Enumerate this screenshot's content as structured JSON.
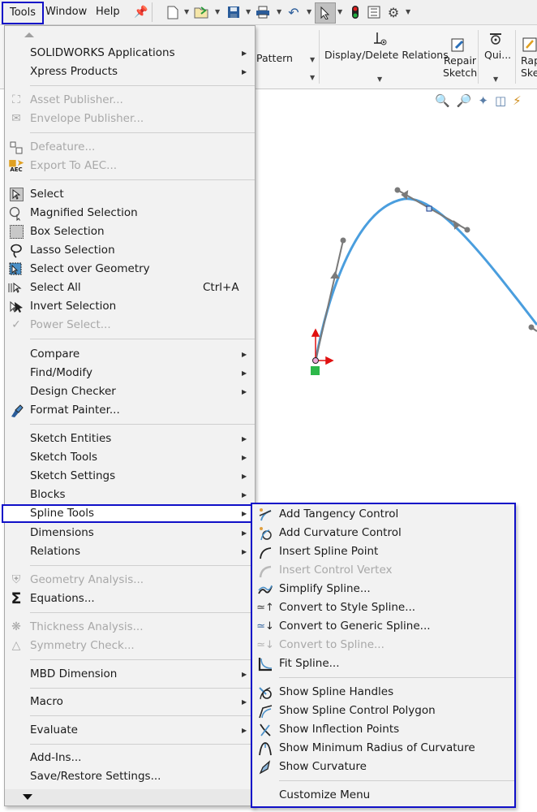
{
  "menubar": {
    "items": [
      {
        "label": "Tools",
        "active": true
      },
      {
        "label": "Window"
      },
      {
        "label": "Help"
      }
    ],
    "pin_icon": "pin-icon"
  },
  "toolbar": {
    "icons": [
      "new-document-icon",
      "open-folder-icon",
      "save-icon",
      "print-icon",
      "undo-icon",
      "select-pointer-icon",
      "traffic-light-icon",
      "file-properties-icon",
      "options-gear-icon"
    ]
  },
  "ribbon": {
    "pattern_label": "Pattern",
    "display_delete_relations_label": "Display/Delete Relations",
    "repair_sketch_label_line1": "Repair",
    "repair_sketch_label_line2": "Sketch",
    "quick_snaps_label": "Qui...",
    "rapid_sketch_label_line1": "Rap",
    "rapid_sketch_label_line2": "Ske"
  },
  "view_toolbar": {
    "icons": [
      "zoom-to-fit-icon",
      "zoom-to-area-icon",
      "previous-view-icon",
      "section-view-icon",
      "dynamic-annotation-icon"
    ]
  },
  "tools_menu": {
    "items": [
      {
        "label": "SOLIDWORKS Applications",
        "submenu": true
      },
      {
        "label": "Xpress Products",
        "submenu": true
      },
      {
        "label": "Asset Publisher...",
        "disabled": true,
        "icon": "asset-publisher-icon"
      },
      {
        "label": "Envelope Publisher...",
        "disabled": true,
        "icon": "envelope-publisher-icon"
      },
      {
        "label": "Defeature...",
        "disabled": true,
        "icon": "defeature-icon"
      },
      {
        "label": "Export To AEC...",
        "disabled": true,
        "icon": "export-aec-icon"
      },
      {
        "label": "Select",
        "icon": "select-icon"
      },
      {
        "label": "Magnified Selection",
        "icon": "magnified-selection-icon"
      },
      {
        "label": "Box Selection",
        "icon": "box-selection-icon"
      },
      {
        "label": "Lasso Selection",
        "icon": "lasso-selection-icon"
      },
      {
        "label": "Select over Geometry",
        "icon": "select-over-geometry-icon"
      },
      {
        "label": "Select All",
        "shortcut": "Ctrl+A",
        "icon": "select-all-icon"
      },
      {
        "label": "Invert Selection",
        "icon": "invert-selection-icon"
      },
      {
        "label": "Power Select...",
        "disabled": true,
        "icon": "power-select-icon"
      },
      {
        "label": "Compare",
        "submenu": true
      },
      {
        "label": "Find/Modify",
        "submenu": true
      },
      {
        "label": "Design Checker",
        "submenu": true
      },
      {
        "label": "Format Painter...",
        "icon": "format-painter-icon"
      },
      {
        "label": "Sketch Entities",
        "submenu": true
      },
      {
        "label": "Sketch Tools",
        "submenu": true
      },
      {
        "label": "Sketch Settings",
        "submenu": true
      },
      {
        "label": "Blocks",
        "submenu": true
      },
      {
        "label": "Spline Tools",
        "submenu": true,
        "highlighted": true
      },
      {
        "label": "Dimensions",
        "submenu": true
      },
      {
        "label": "Relations",
        "submenu": true
      },
      {
        "label": "Geometry Analysis...",
        "disabled": true,
        "icon": "geometry-analysis-icon"
      },
      {
        "label": "Equations...",
        "icon": "sigma-icon"
      },
      {
        "label": "Thickness Analysis...",
        "disabled": true,
        "icon": "thickness-analysis-icon"
      },
      {
        "label": "Symmetry Check...",
        "disabled": true,
        "icon": "symmetry-check-icon"
      },
      {
        "label": "MBD Dimension",
        "submenu": true
      },
      {
        "label": "Macro",
        "submenu": true
      },
      {
        "label": "Evaluate",
        "submenu": true
      },
      {
        "label": "Add-Ins..."
      },
      {
        "label": "Save/Restore Settings..."
      }
    ]
  },
  "spline_tools_submenu": {
    "items": [
      {
        "label": "Add Tangency Control",
        "icon": "add-tangency-control-icon"
      },
      {
        "label": "Add Curvature Control",
        "icon": "add-curvature-control-icon"
      },
      {
        "label": "Insert Spline Point",
        "icon": "insert-spline-point-icon"
      },
      {
        "label": "Insert Control Vertex",
        "disabled": true,
        "icon": "insert-control-vertex-icon"
      },
      {
        "label": "Simplify Spline...",
        "icon": "simplify-spline-icon"
      },
      {
        "label": "Convert to Style Spline...",
        "icon": "convert-style-spline-icon"
      },
      {
        "label": "Convert to Generic Spline...",
        "icon": "convert-generic-spline-icon"
      },
      {
        "label": "Convert to Spline...",
        "disabled": true,
        "icon": "convert-to-spline-icon"
      },
      {
        "label": "Fit Spline...",
        "icon": "fit-spline-icon"
      },
      {
        "label": "Show Spline Handles",
        "icon": "show-spline-handles-icon"
      },
      {
        "label": "Show Spline Control Polygon",
        "icon": "show-control-polygon-icon"
      },
      {
        "label": "Show Inflection Points",
        "icon": "show-inflection-points-icon"
      },
      {
        "label": "Show Minimum Radius of Curvature",
        "icon": "show-min-radius-icon"
      },
      {
        "label": "Show Curvature",
        "icon": "show-curvature-icon"
      },
      {
        "label": "Customize Menu"
      }
    ]
  },
  "colors": {
    "highlight_border": "#1010c8",
    "spline": "#4a9ede",
    "handle": "#7a7a7a",
    "origin_axis": "#e01010",
    "origin_marker": "#2db84a"
  }
}
